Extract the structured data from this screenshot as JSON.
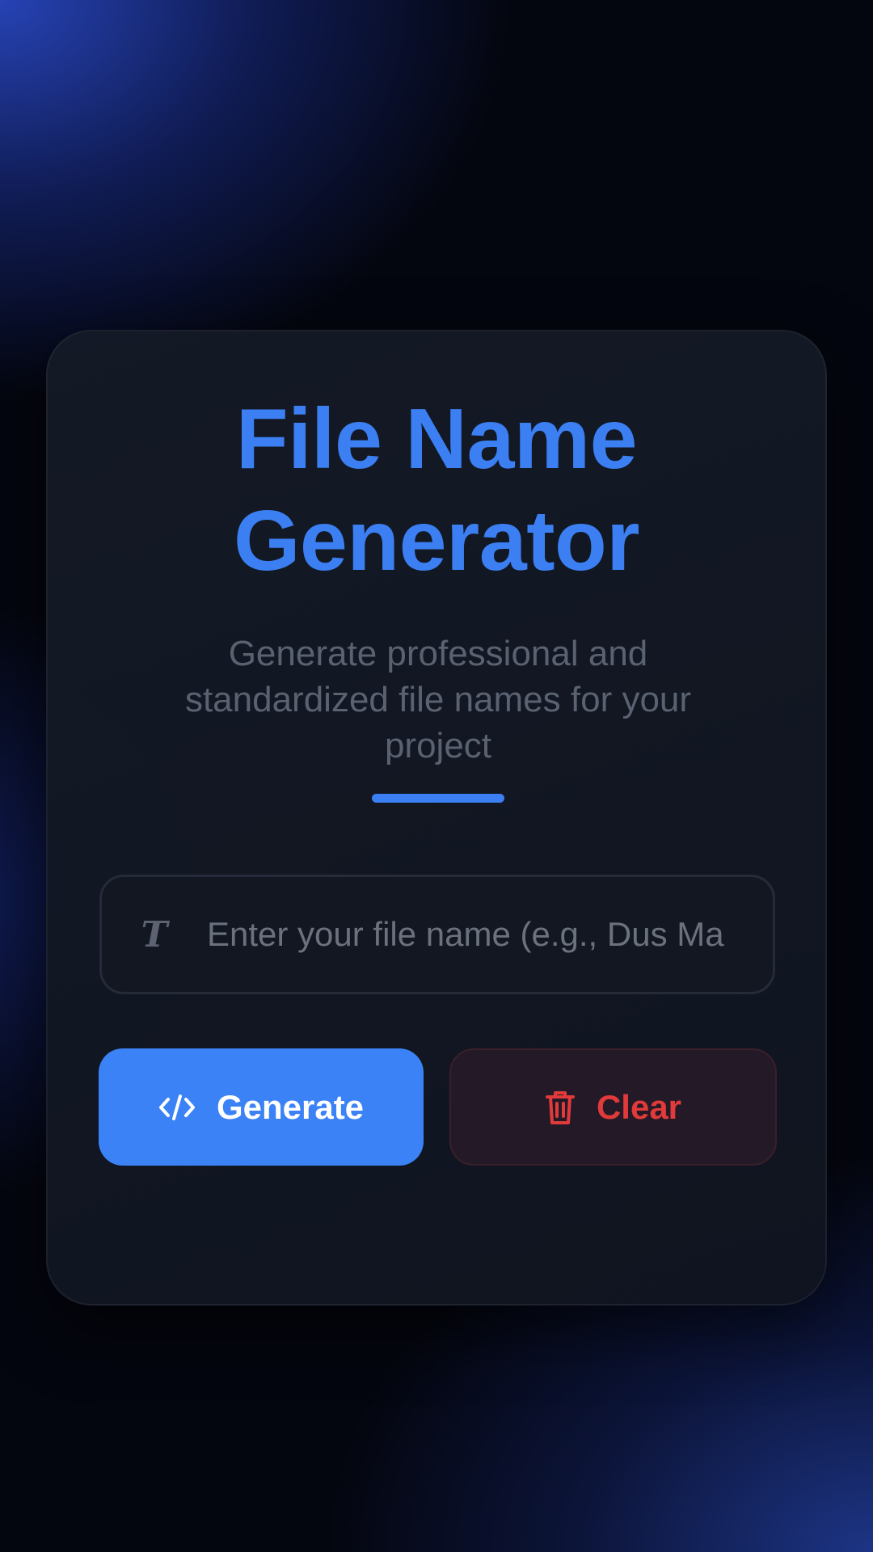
{
  "card": {
    "title_line1": "File Name",
    "title_line2": "Generator",
    "subtitle": "Generate professional and standardized file names for your project"
  },
  "input": {
    "placeholder": "Enter your file name (e.g., Dus Ma",
    "value": "",
    "icon": "text-type-icon"
  },
  "buttons": {
    "generate": {
      "label": "Generate",
      "icon": "code-icon"
    },
    "clear": {
      "label": "Clear",
      "icon": "trash-icon"
    }
  },
  "colors": {
    "accent": "#3b7ff2",
    "primary_button": "#3b82f6",
    "danger": "#e03a3a"
  }
}
